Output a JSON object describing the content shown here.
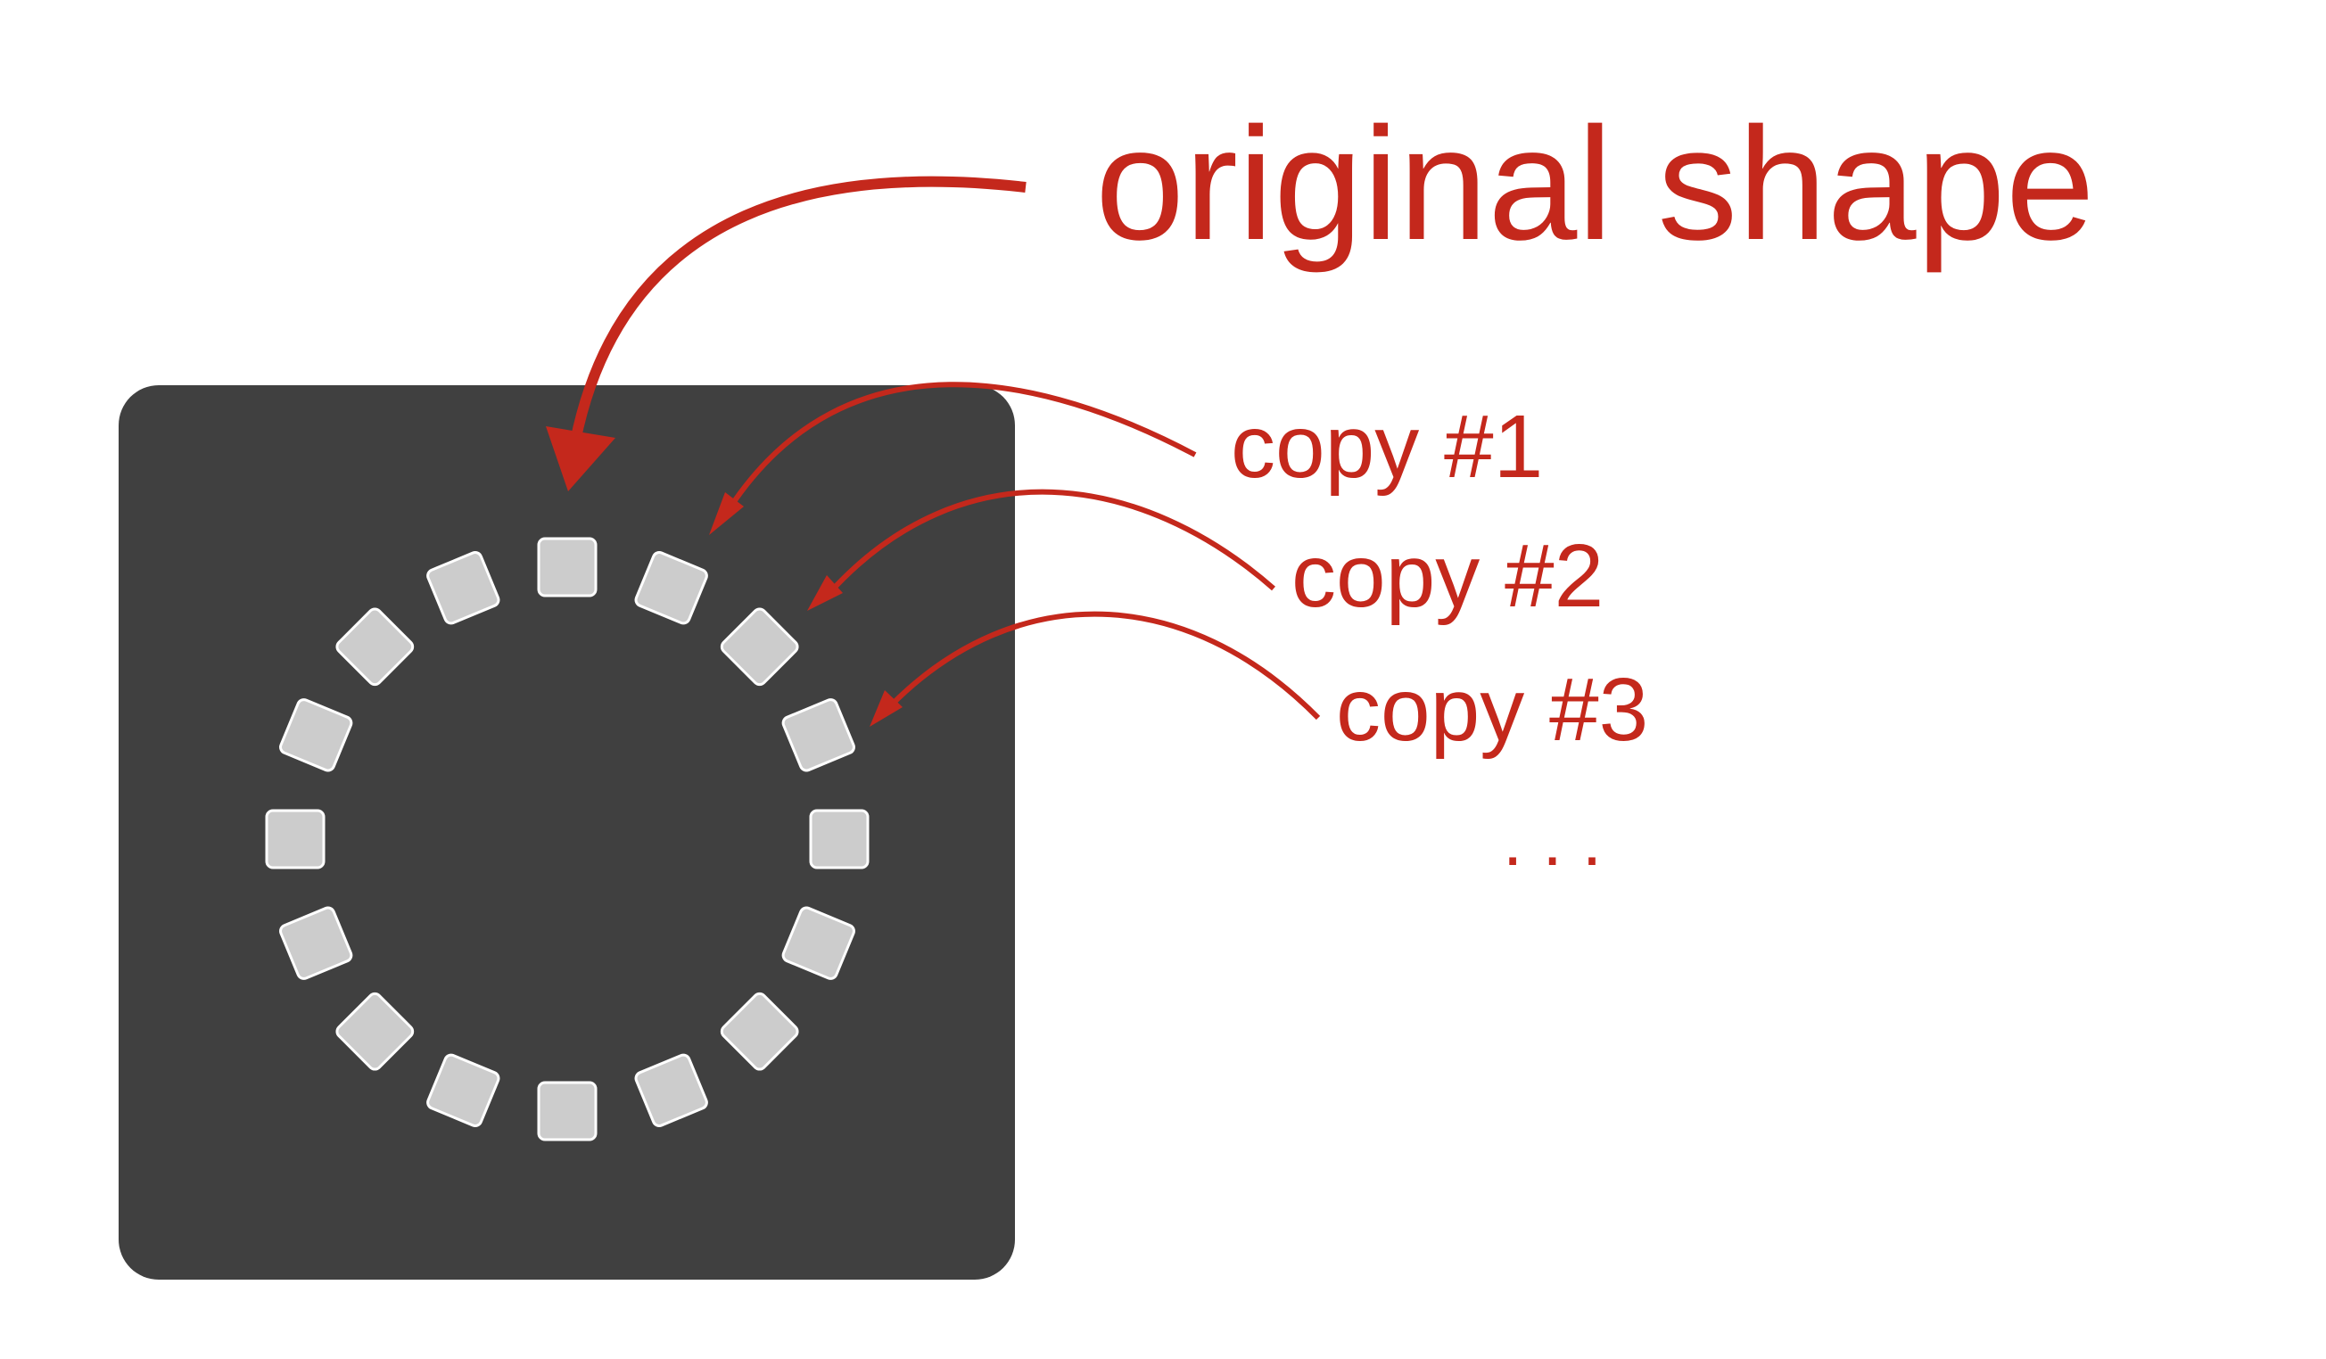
{
  "colors": {
    "background": "#ffffff",
    "panel": "#404040",
    "square_fill": "#cccccc",
    "square_stroke": "#ffffff",
    "annotation": "#c4281c"
  },
  "shape": {
    "description_label": "original shape",
    "ring_count": 16
  },
  "copies": [
    {
      "label": "copy #1"
    },
    {
      "label": "copy #2"
    },
    {
      "label": "copy #3"
    }
  ],
  "ellipsis": ". . ."
}
